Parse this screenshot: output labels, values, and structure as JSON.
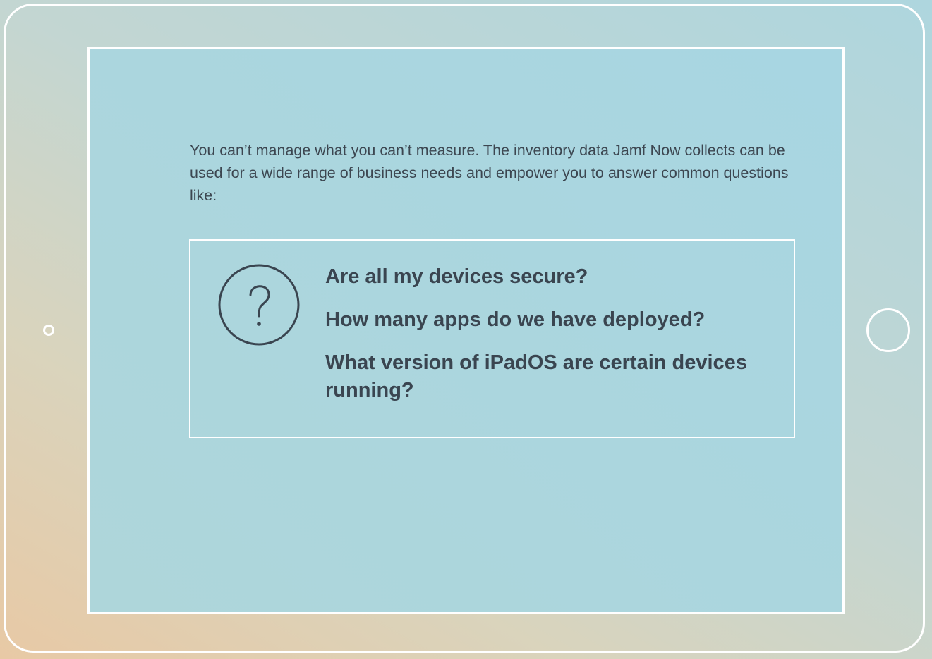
{
  "intro": {
    "text": "You can’t manage what you can’t measure. The inventory data Jamf Now collects can be used for a wide range of business needs and empower you to answer common questions like:"
  },
  "questions": {
    "icon": "question-mark-circle-icon",
    "items": [
      "Are all my devices secure?",
      "How many apps do we have deployed?",
      "What version of iPadOS are certain devices running?"
    ]
  },
  "colors": {
    "frame": "#ffffff",
    "text": "#3a4550",
    "screen_bg": "#a8d6e0"
  }
}
